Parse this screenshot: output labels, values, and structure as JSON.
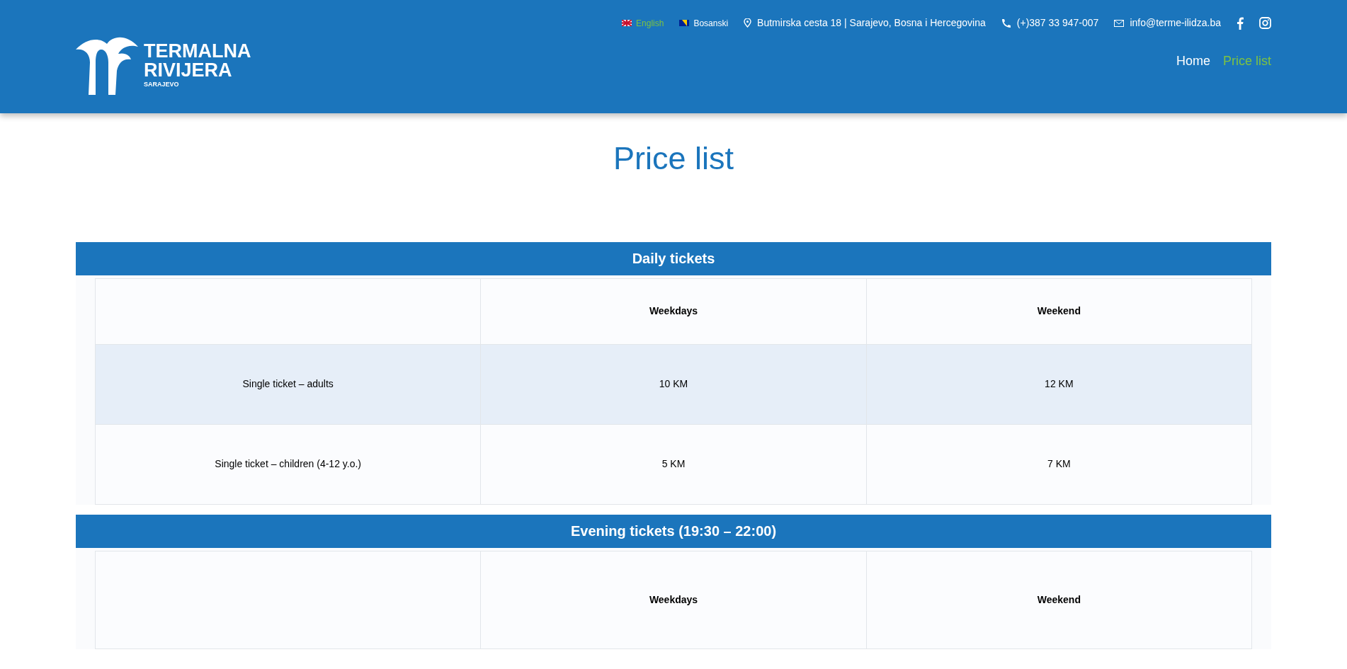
{
  "header": {
    "logo": {
      "line1": "TERMALNA",
      "line2": "RIVIJERA",
      "line3": "SARAJEVO"
    },
    "languages": [
      {
        "label": "English",
        "kind": "uk",
        "selected": true
      },
      {
        "label": "Bosanski",
        "kind": "ba",
        "selected": false
      }
    ],
    "contacts": [
      {
        "kind": "address",
        "text": "Butmirska cesta 18 | Sarajevo, Bosna i Hercegovina"
      },
      {
        "kind": "phone",
        "text": "(+)387 33 947-007"
      },
      {
        "kind": "email",
        "text": "info@terme-ilidza.ba"
      }
    ],
    "social": [
      {
        "kind": "facebook"
      },
      {
        "kind": "instagram"
      }
    ],
    "nav": [
      {
        "label": "Home",
        "selected": false
      },
      {
        "label": "Price list",
        "selected": true
      }
    ]
  },
  "page_title": "Price list",
  "sections": [
    {
      "title": "Daily tickets",
      "columns": [
        "Weekdays",
        "Weekend"
      ],
      "rows": [
        {
          "label": "Single ticket – adults",
          "values": [
            "10 KM",
            "12 KM"
          ]
        },
        {
          "label": "Single ticket – children (4-12 y.o.)",
          "values": [
            "5 KM",
            "7 KM"
          ]
        }
      ]
    },
    {
      "title": "Evening tickets (19:30 – 22:00)",
      "columns": [
        "Weekdays",
        "Weekend"
      ]
    }
  ]
}
